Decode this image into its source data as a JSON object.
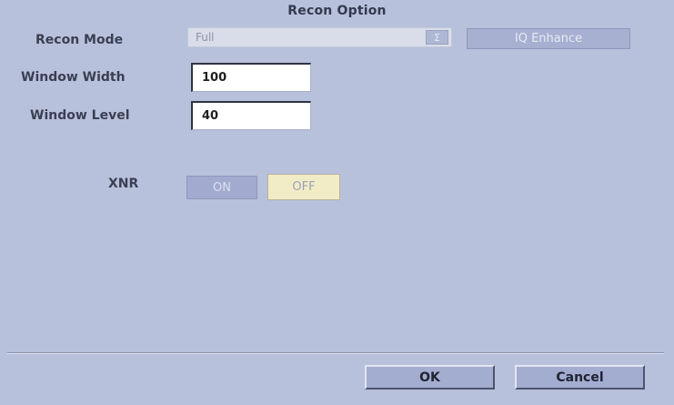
{
  "dialog": {
    "title": "Recon Option",
    "recon_mode": {
      "label": "Recon Mode",
      "value": "Full",
      "iq_enhance_label": "IQ Enhance"
    },
    "window_width": {
      "label": "Window Width",
      "value": "100"
    },
    "window_level": {
      "label": "Window Level",
      "value": "40"
    },
    "xnr": {
      "label": "XNR",
      "on_label": "ON",
      "off_label": "OFF",
      "selected": "OFF"
    },
    "footer": {
      "ok_label": "OK",
      "cancel_label": "Cancel"
    }
  },
  "colors": {
    "background": "#b8c1dc",
    "selected_toggle": "#f2ecc6",
    "button_face": "#a3add0"
  }
}
